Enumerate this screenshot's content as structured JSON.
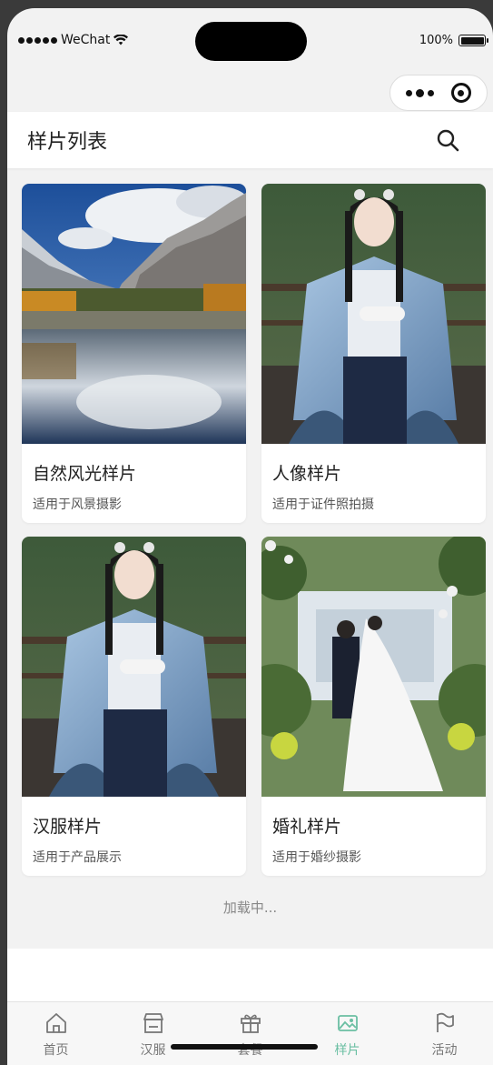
{
  "status": {
    "carrier": "WeChat",
    "battery": "100%"
  },
  "header": {
    "title": "样片列表"
  },
  "cards": [
    {
      "name": "自然风光样片",
      "desc": "适用于风景摄影",
      "image": "mountain-lake-landscape"
    },
    {
      "name": "人像样片",
      "desc": "适用于证件照拍摄",
      "image": "hanfu-portrait"
    },
    {
      "name": "汉服样片",
      "desc": "适用于产品展示",
      "image": "hanfu-portrait"
    },
    {
      "name": "婚礼样片",
      "desc": "适用于婚纱摄影",
      "image": "wedding-scene"
    }
  ],
  "loading": "加载中...",
  "tabs": [
    {
      "label": "首页",
      "icon": "home-icon"
    },
    {
      "label": "汉服",
      "icon": "store-icon"
    },
    {
      "label": "套餐",
      "icon": "gift-icon"
    },
    {
      "label": "样片",
      "icon": "image-icon",
      "active": true
    },
    {
      "label": "活动",
      "icon": "flag-icon"
    }
  ],
  "colors": {
    "accent": "#6bbfa3",
    "background": "#f2f2f2"
  }
}
